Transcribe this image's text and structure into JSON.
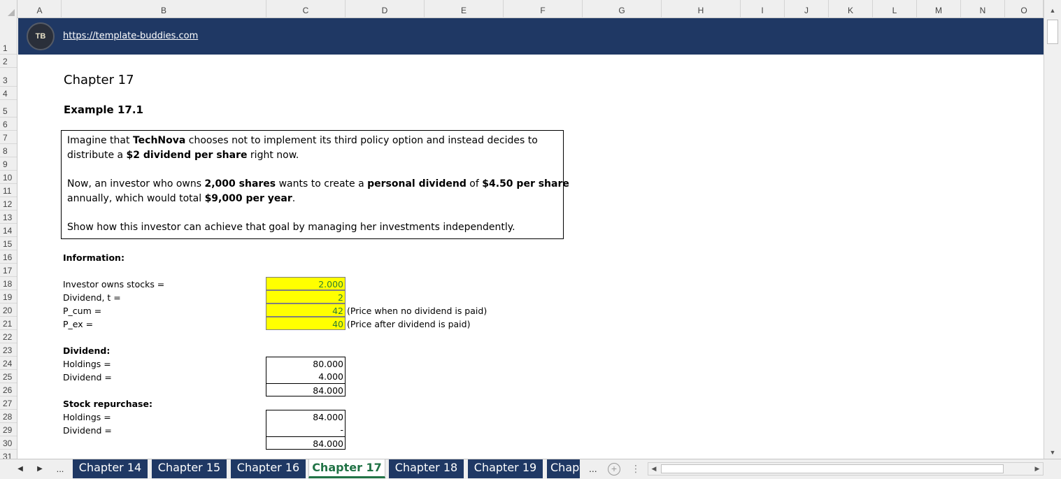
{
  "columns": [
    "A",
    "B",
    "C",
    "D",
    "E",
    "F",
    "G",
    "H",
    "I",
    "J",
    "K",
    "L",
    "M",
    "N",
    "O"
  ],
  "rows": [
    "1",
    "2",
    "3",
    "4",
    "5",
    "6",
    "7",
    "8",
    "9",
    "10",
    "11",
    "12",
    "13",
    "14",
    "15",
    "16",
    "17",
    "18",
    "19",
    "20",
    "21",
    "22",
    "23",
    "24",
    "25",
    "26",
    "27",
    "28",
    "29",
    "30",
    "31"
  ],
  "banner": {
    "url": "https://template-buddies.com",
    "logo_text": "TB"
  },
  "title": "Chapter 17",
  "example": "Example 17.1",
  "textbox": {
    "p1_a": "Imagine that ",
    "p1_b": "TechNova",
    "p1_c": " chooses not to implement its third policy option and instead decides to",
    "p1_d": "distribute a ",
    "p1_e": "$2 dividend per share",
    "p1_f": " right now.",
    "p2_a": "Now, an investor who owns ",
    "p2_b": "2,000 shares",
    "p2_c": " wants to create a ",
    "p2_d": "personal dividend",
    "p2_e": " of ",
    "p2_f": "$4.50 per share",
    "p2_g": "annually, which would total ",
    "p2_h": "$9,000 per year",
    "p2_i": ".",
    "p3": "Show how this investor can achieve that goal by managing her investments independently."
  },
  "information": {
    "heading": "Information:",
    "items": [
      {
        "label": "Investor owns stocks =",
        "value": "2.000",
        "note": ""
      },
      {
        "label": "Dividend, t =",
        "value": "2",
        "note": ""
      },
      {
        "label": "P_cum =",
        "value": "42",
        "note": "(Price when no dividend is paid)"
      },
      {
        "label": "P_ex =",
        "value": "40",
        "note": "(Price after dividend is paid)"
      }
    ]
  },
  "dividend": {
    "heading": "Dividend:",
    "holdings_label": "Holdings =",
    "holdings_value": "80.000",
    "dividend_label": "Dividend =",
    "dividend_value": "4.000",
    "total": "84.000"
  },
  "repurchase": {
    "heading": "Stock repurchase:",
    "holdings_label": "Holdings =",
    "holdings_value": "84.000",
    "dividend_label": "Dividend =",
    "dividend_value": "-",
    "total": "84.000"
  },
  "tabs": [
    "Chapter 14",
    "Chapter 15",
    "Chapter 16",
    "Chapter 17",
    "Chapter 18",
    "Chapter 19",
    "Chapt"
  ],
  "active_tab": "Chapter 17",
  "tabbar": {
    "more": "...",
    "ellipsis_left": "...",
    "add": "+",
    "dots": "⋮"
  },
  "colors": {
    "banner": "#1f3864",
    "input_fill": "#ffff00",
    "input_text": "#2e7d32",
    "active_tab_text": "#217346"
  }
}
